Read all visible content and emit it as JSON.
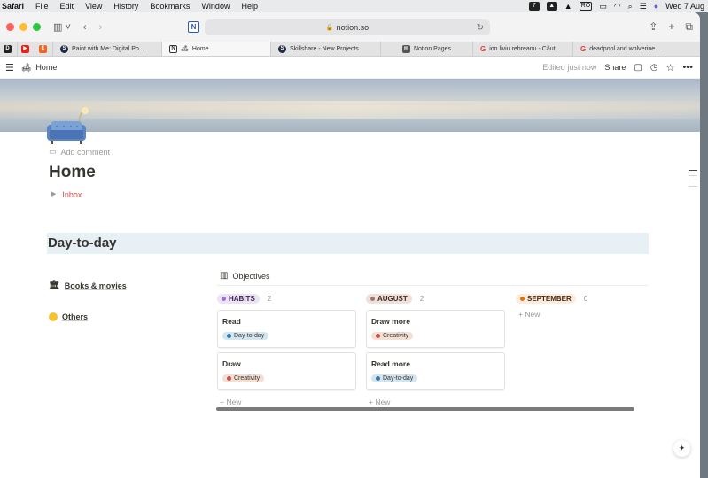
{
  "menubar": {
    "app": "Safari",
    "menus": [
      "File",
      "Edit",
      "View",
      "History",
      "Bookmarks",
      "Window",
      "Help"
    ],
    "status": {
      "date_badge": "7",
      "input": "RO",
      "clock": "Wed 7 Aug"
    }
  },
  "browser": {
    "url": "notion.so",
    "tabs": [
      {
        "label": "Paint with Me: Digital Po...",
        "favicon": "Sk",
        "color": "#1f2a44",
        "active": false
      },
      {
        "label": "Home",
        "favicon": "N",
        "color": "#ffffff",
        "active": true
      },
      {
        "label": "Skillshare - New Projects",
        "favicon": "Sk",
        "color": "#1f2a44",
        "active": false
      },
      {
        "label": "Notion Pages",
        "favicon": "▤",
        "color": "#555555",
        "active": false
      },
      {
        "label": "ion liviu rebreanu - Căut...",
        "favicon": "G",
        "color": "#ffffff",
        "active": false
      },
      {
        "label": "deadpool and wolverine...",
        "favicon": "G",
        "color": "#ffffff",
        "active": false
      }
    ]
  },
  "notion_header": {
    "breadcrumb": "Home",
    "edited": "Edited just now",
    "share": "Share"
  },
  "page": {
    "add_comment": "Add comment",
    "title": "Home",
    "toggle": "Inbox",
    "callout": "Day-to-day",
    "side_items": [
      {
        "label": "Books & movies",
        "icon": "museum-icon"
      },
      {
        "label": "Others",
        "icon": "yellow-circle-icon"
      }
    ]
  },
  "board": {
    "title": "Objectives",
    "columns": [
      {
        "name": "HABITS",
        "count": "2",
        "bg": "#ebe4f2",
        "dot": "#9a6dd7",
        "color": "#412454",
        "cards": [
          {
            "title": "Read",
            "tag": "Day-to-day",
            "tag_bg": "#d3e5ef",
            "tag_dot": "#337ea9"
          },
          {
            "title": "Draw",
            "tag": "Creativity",
            "tag_bg": "#f4dfd4",
            "tag_dot": "#c4554d"
          }
        ],
        "new_label": "New"
      },
      {
        "name": "AUGUST",
        "count": "2",
        "bg": "#eee0da",
        "dot": "#a27763",
        "color": "#442a1e",
        "cards": [
          {
            "title": "Draw more",
            "tag": "Creativity",
            "tag_bg": "#f4dfd4",
            "tag_dot": "#c4554d"
          },
          {
            "title": "Read more",
            "tag": "Day-to-day",
            "tag_bg": "#d3e5ef",
            "tag_dot": "#337ea9"
          }
        ],
        "new_label": "New"
      },
      {
        "name": "SEPTEMBER",
        "count": "0",
        "bg": "#fbecdd",
        "dot": "#d9730d",
        "color": "#49290e",
        "cards": [],
        "new_label": "New"
      }
    ]
  }
}
